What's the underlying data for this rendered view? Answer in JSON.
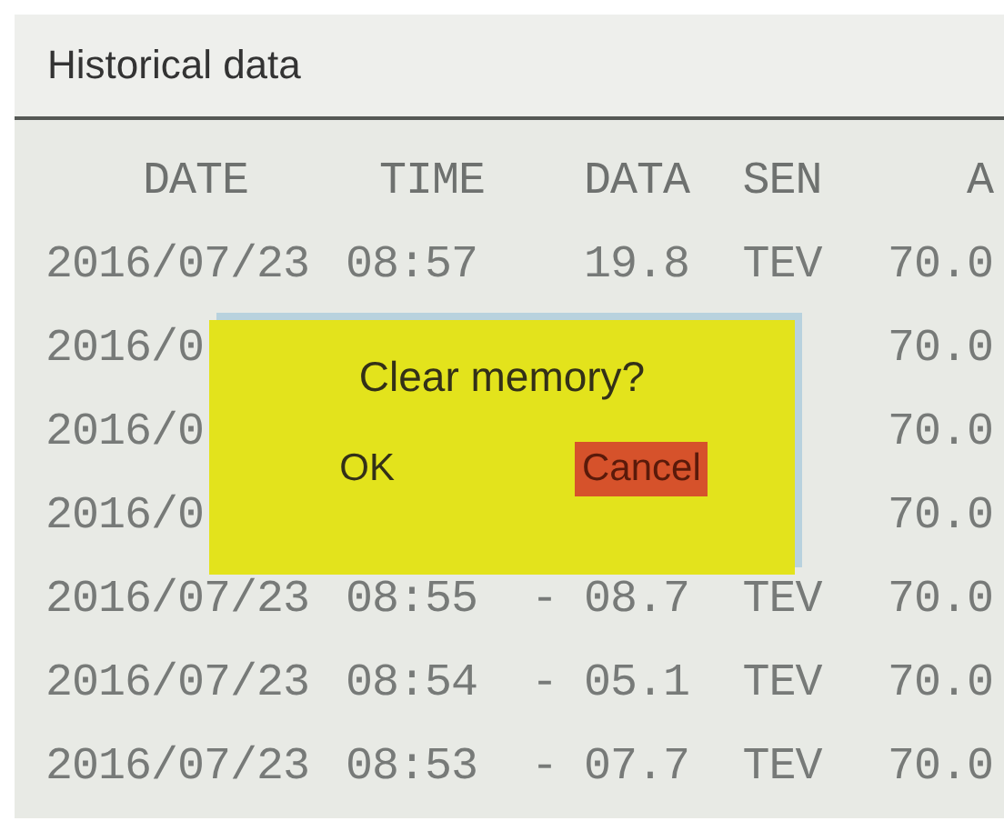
{
  "title": "Historical data",
  "table": {
    "columns": [
      "DATE",
      "TIME",
      "DATA",
      "SEN",
      "A"
    ],
    "rows": [
      {
        "date": "2016/07/23",
        "time": "08:57",
        "data": "19.8",
        "sen": "TEV",
        "a": "70.0"
      },
      {
        "date": "2016/0",
        "a": "70.0"
      },
      {
        "date": "2016/0",
        "a": "70.0"
      },
      {
        "date": "2016/0",
        "a": "70.0"
      },
      {
        "date": "2016/07/23",
        "time": "08:55",
        "data": "- 08.7",
        "sen": "TEV",
        "a": "70.0"
      },
      {
        "date": "2016/07/23",
        "time": "08:54",
        "data": "- 05.1",
        "sen": "TEV",
        "a": "70.0"
      },
      {
        "date": "2016/07/23",
        "time": "08:53",
        "data": "- 07.7",
        "sen": "TEV",
        "a": "70.0"
      }
    ]
  },
  "dialog": {
    "message": "Clear memory?",
    "buttons": [
      {
        "label": "OK",
        "selected": false
      },
      {
        "label": "Cancel",
        "selected": true
      }
    ]
  }
}
